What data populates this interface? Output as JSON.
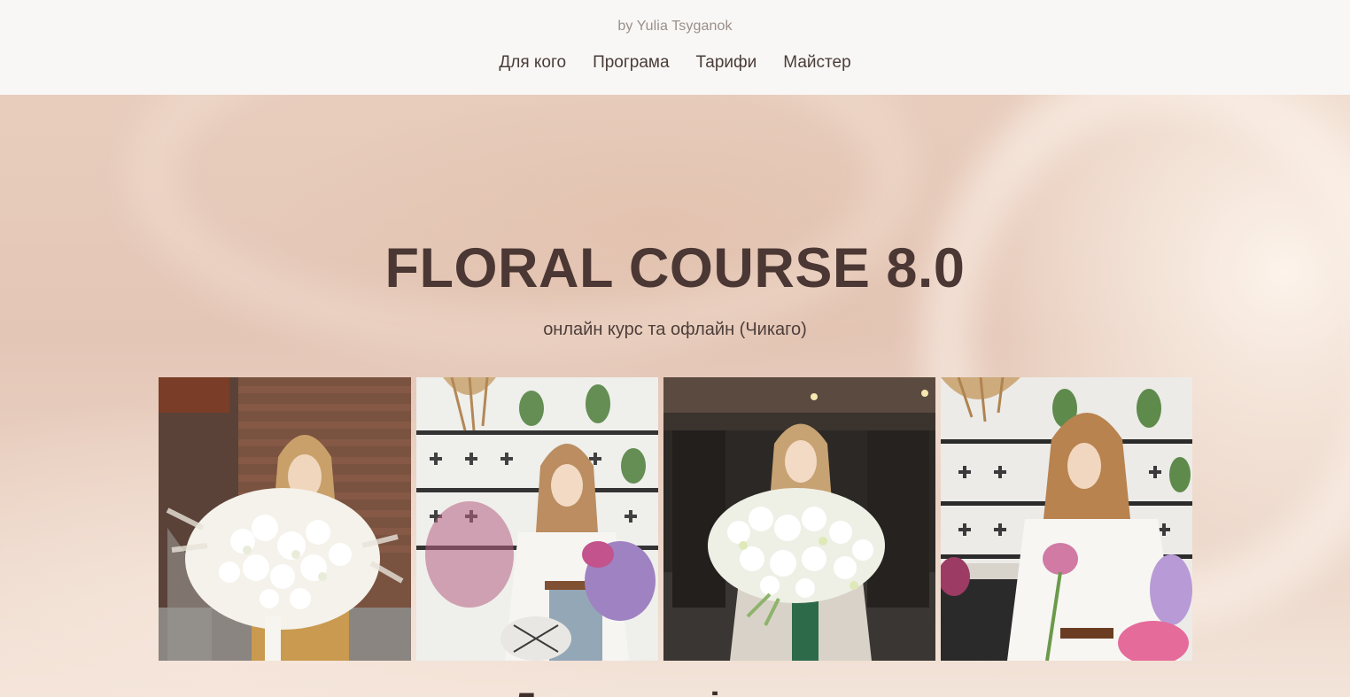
{
  "header": {
    "byline": "by Yulia Tsyganok",
    "nav": [
      {
        "label": "Для кого"
      },
      {
        "label": "Програма"
      },
      {
        "label": "Тарифи"
      },
      {
        "label": "Майстер"
      }
    ]
  },
  "hero": {
    "title": "FLORAL COURSE 8.0",
    "subtitle": "онлайн курс та офлайн (Чикаго)"
  },
  "gallery": {
    "photos": [
      {
        "description": "photo-woman-white-bouquet-brick-wall"
      },
      {
        "description": "photo-woman-arranging-flowers-tiled-wall"
      },
      {
        "description": "photo-woman-white-bouquet-dark-room"
      },
      {
        "description": "photo-woman-pink-flower-tiled-wall"
      }
    ]
  },
  "next_section": {
    "heading_partial": "Для кого ці курси"
  },
  "colors": {
    "text_dark": "#4b3733",
    "hero_bg": "#e4c6b6",
    "topbar_bg": "#f8f7f5"
  }
}
